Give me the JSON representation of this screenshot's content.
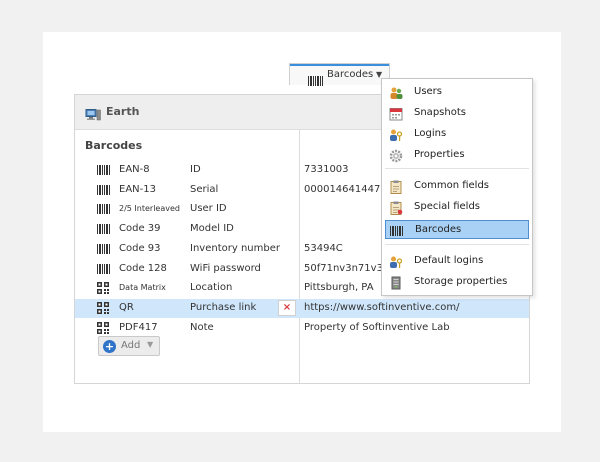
{
  "panel": {
    "title": "Earth",
    "section_title": "Barcodes",
    "rows": [
      {
        "type": "EAN-8",
        "field": "ID",
        "value": "7331003",
        "icon": "barcode-icon"
      },
      {
        "type": "EAN-13",
        "field": "Serial",
        "value": "000014641447",
        "icon": "barcode-icon"
      },
      {
        "type": "2/5 Interleaved",
        "field": "User ID",
        "value": "",
        "icon": "barcode-icon"
      },
      {
        "type": "Code 39",
        "field": "Model ID",
        "value": "",
        "icon": "barcode-icon"
      },
      {
        "type": "Code 93",
        "field": "Inventory number",
        "value": "53494C",
        "icon": "barcode-icon"
      },
      {
        "type": "Code 128",
        "field": "WiFi password",
        "value": "50f71nv3n71v3",
        "icon": "barcode-icon"
      },
      {
        "type": "Data Matrix",
        "field": "Location",
        "value": "Pittsburgh, PA",
        "icon": "matrix-code-icon"
      },
      {
        "type": "QR",
        "field": "Purchase link",
        "value": "https://www.softinventive.com/",
        "icon": "qr-code-icon"
      },
      {
        "type": "PDF417",
        "field": "Note",
        "value": "Property of Softinventive Lab",
        "icon": "matrix-code-icon"
      }
    ],
    "delete_symbol": "×",
    "add_label": "Add"
  },
  "tab": {
    "label": "Barcodes"
  },
  "menu": {
    "items": [
      {
        "label": "Users",
        "icon": "users-icon"
      },
      {
        "label": "Snapshots",
        "icon": "calendar-icon"
      },
      {
        "label": "Logins",
        "icon": "key-user-icon"
      },
      {
        "label": "Properties",
        "icon": "gear-icon"
      },
      {
        "label": "Common fields",
        "icon": "clipboard-icon"
      },
      {
        "label": "Special fields",
        "icon": "clipboard-icon"
      },
      {
        "label": "Barcodes",
        "icon": "barcode-icon"
      },
      {
        "label": "Default logins",
        "icon": "key-user-icon"
      },
      {
        "label": "Storage properties",
        "icon": "storage-icon"
      }
    ]
  },
  "colors": {
    "accent": "#3b8edb",
    "selection": "#cfe6fb",
    "menu_highlight": "#a9d1f5",
    "delete": "#d9363e"
  }
}
